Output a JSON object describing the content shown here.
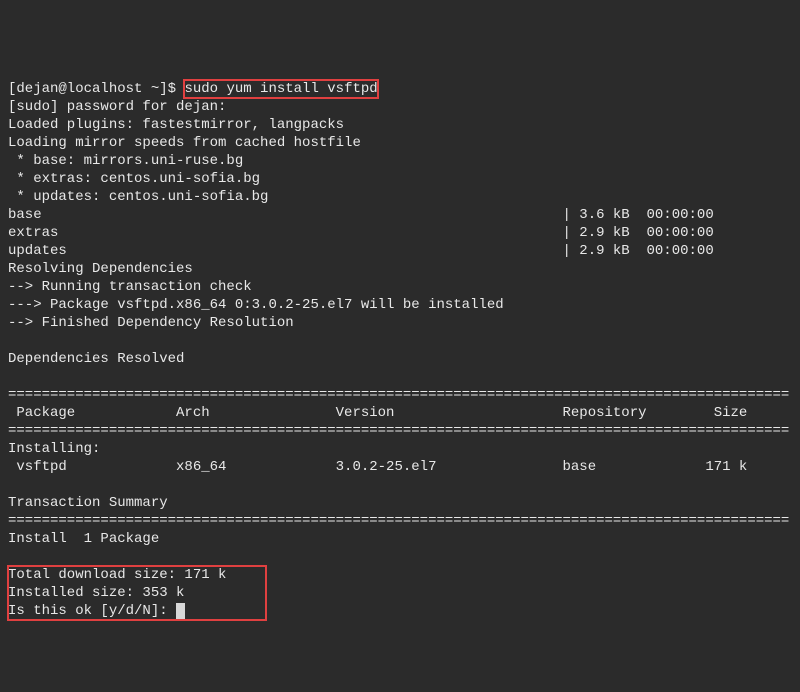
{
  "prompt": {
    "user_host": "[dejan@localhost ~]$ ",
    "command": "sudo yum install vsftpd"
  },
  "output": {
    "sudo_line": "[sudo] password for dejan:",
    "plugins": "Loaded plugins: fastestmirror, langpacks",
    "mirror_load": "Loading mirror speeds from cached hostfile",
    "mirror_base": " * base: mirrors.uni-ruse.bg",
    "mirror_extras": " * extras: centos.uni-sofia.bg",
    "mirror_updates": " * updates: centos.uni-sofia.bg",
    "repo_base": "base                                                              | 3.6 kB  00:00:00",
    "repo_extras": "extras                                                            | 2.9 kB  00:00:00",
    "repo_updates": "updates                                                           | 2.9 kB  00:00:00",
    "resolving": "Resolving Dependencies",
    "trans_check": "--> Running transaction check",
    "pkg_install": "---> Package vsftpd.x86_64 0:3.0.2-25.el7 will be installed",
    "finished": "--> Finished Dependency Resolution",
    "deps_resolved": "Dependencies Resolved",
    "ruler": "=============================================================================================",
    "table_header": " Package            Arch               Version                    Repository        Size",
    "installing": "Installing:",
    "pkg_row": " vsftpd             x86_64             3.0.2-25.el7               base             171 k",
    "trans_summary": "Transaction Summary",
    "install_count": "Install  1 Package",
    "dl_size": "Total download size: 171 k",
    "inst_size": "Installed size: 353 k",
    "confirm": "Is this ok [y/d/N]: "
  }
}
